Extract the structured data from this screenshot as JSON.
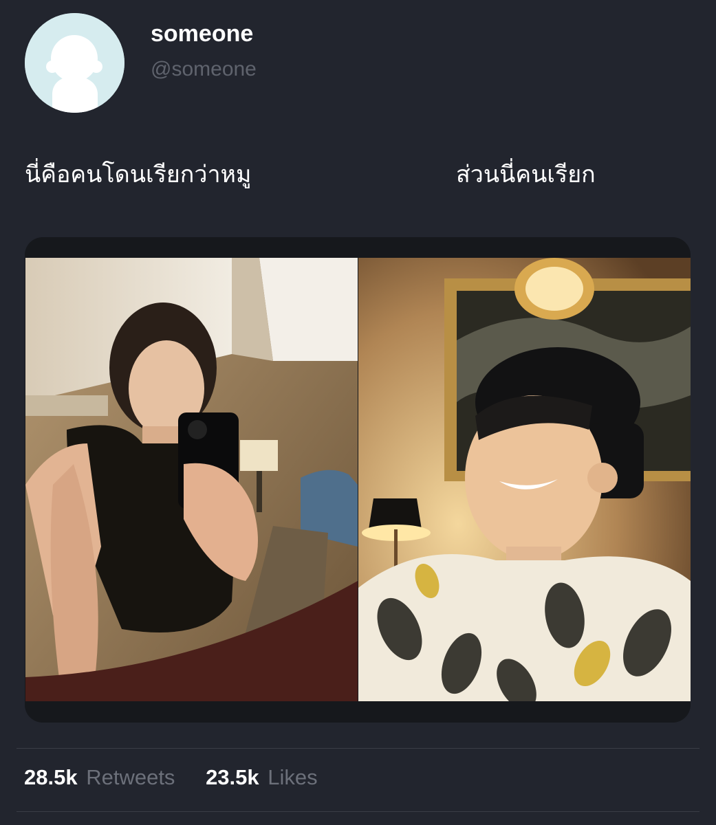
{
  "author": {
    "display_name": "someone",
    "handle": "@someone"
  },
  "tweet": {
    "text_left": "นี่คือคนโดนเรียกว่าหมู",
    "text_right": "ส่วนนี่คนเรียก"
  },
  "media": {
    "photos": [
      {
        "icon": "photo-mirror-selfie"
      },
      {
        "icon": "photo-smiling-man-cap"
      }
    ]
  },
  "stats": {
    "retweets_count": "28.5k",
    "retweets_label": "Retweets",
    "likes_count": "23.5k",
    "likes_label": "Likes"
  },
  "colors": {
    "background": "#22252e",
    "avatar_bg": "#d6ecef",
    "muted_text": "#5f636d"
  }
}
